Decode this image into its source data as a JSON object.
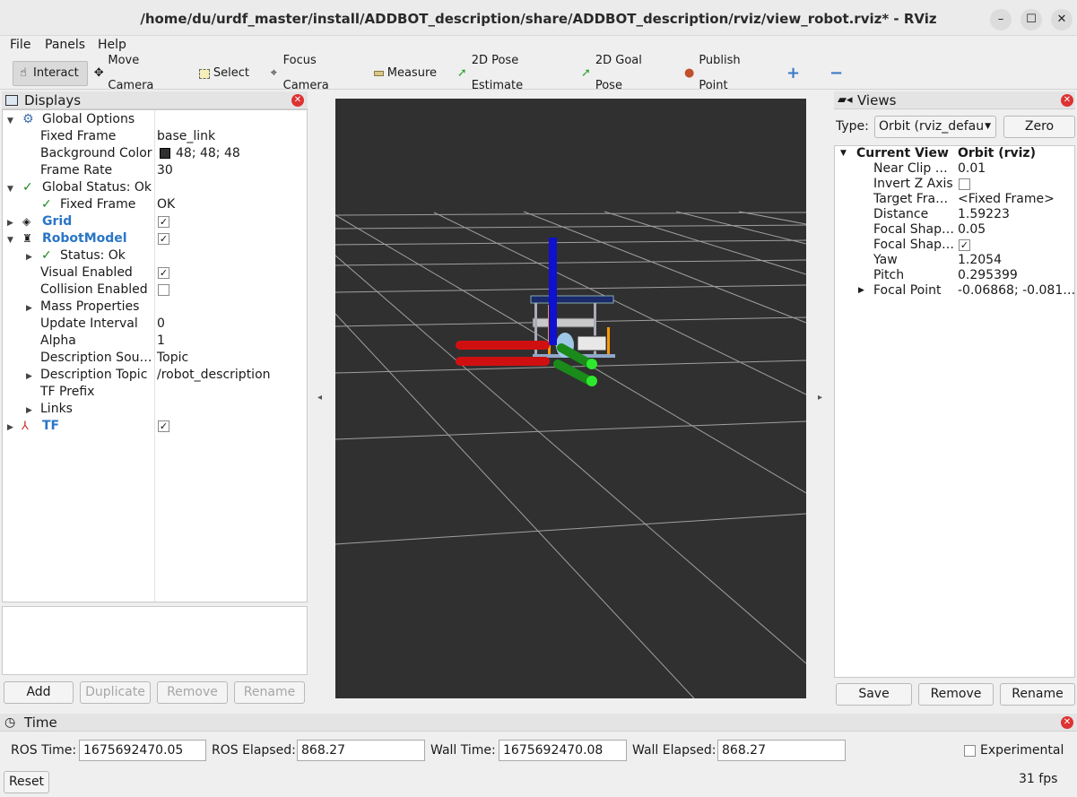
{
  "window": {
    "title": "/home/du/urdf_master/install/ADDBOT_description/share/ADDBOT_description/rviz/view_robot.rviz* - RViz",
    "minimize": "–",
    "maximize": "☐",
    "close": "✕"
  },
  "menu": {
    "file": "File",
    "panels": "Panels",
    "help": "Help"
  },
  "toolbar": {
    "interact": "Interact",
    "move_camera": "Move Camera",
    "select": "Select",
    "focus_camera": "Focus Camera",
    "measure": "Measure",
    "pose_estimate": "2D Pose Estimate",
    "goal_pose": "2D Goal Pose",
    "publish_point": "Publish Point",
    "add_tool": "+",
    "remove_tool": "−"
  },
  "displays": {
    "title": "Displays",
    "rows": {
      "global_options": "Global Options",
      "fixed_frame": "Fixed Frame",
      "fixed_frame_value": "base_link",
      "background_color": "Background Color",
      "background_color_value": "48; 48; 48",
      "frame_rate": "Frame Rate",
      "frame_rate_value": "30",
      "global_status": "Global Status: Ok",
      "status_fixed_frame": "Fixed Frame",
      "status_fixed_frame_value": "OK",
      "grid": "Grid",
      "robot_model": "RobotModel",
      "status_ok": "Status: Ok",
      "visual_enabled": "Visual Enabled",
      "collision_enabled": "Collision Enabled",
      "mass_properties": "Mass Properties",
      "update_interval": "Update Interval",
      "update_interval_value": "0",
      "alpha": "Alpha",
      "alpha_value": "1",
      "description_source": "Description Sou…",
      "description_source_value": "Topic",
      "description_topic": "Description Topic",
      "description_topic_value": "/robot_description",
      "tf_prefix": "TF Prefix",
      "links": "Links",
      "tf": "TF"
    },
    "background_color_hex": "#303030",
    "buttons": {
      "add": "Add",
      "duplicate": "Duplicate",
      "remove": "Remove",
      "rename": "Rename"
    }
  },
  "views": {
    "title": "Views",
    "type_label": "Type:",
    "type_value": "Orbit (rviz_defau",
    "zero": "Zero",
    "rows": {
      "current_view": "Current View",
      "current_view_value": "Orbit (rviz)",
      "near_clip": "Near Clip …",
      "near_clip_value": "0.01",
      "invert_z": "Invert Z Axis",
      "target_frame": "Target Fra…",
      "target_frame_value": "<Fixed Frame>",
      "distance": "Distance",
      "distance_value": "1.59223",
      "focal_shape_1": "Focal Shap…",
      "focal_shape_1_value": "0.05",
      "focal_shape_2": "Focal Shap…",
      "yaw": "Yaw",
      "yaw_value": "1.2054",
      "pitch": "Pitch",
      "pitch_value": "0.295399",
      "focal_point": "Focal Point",
      "focal_point_value": "-0.06868; -0.081…"
    },
    "buttons": {
      "save": "Save",
      "remove": "Remove",
      "rename": "Rename"
    }
  },
  "time": {
    "title": "Time",
    "ros_time_label": "ROS Time:",
    "ros_time_value": "1675692470.05",
    "ros_elapsed_label": "ROS Elapsed:",
    "ros_elapsed_value": "868.27",
    "wall_time_label": "Wall Time:",
    "wall_time_value": "1675692470.08",
    "wall_elapsed_label": "Wall Elapsed:",
    "wall_elapsed_value": "868.27",
    "experimental_label": "Experimental",
    "reset": "Reset",
    "fps": "31 fps"
  },
  "colors": {
    "accent_blue": "#2a76c6",
    "status_green": "#1d8a1d",
    "viewport_bg": "#303030",
    "close_red": "#dd3333"
  }
}
